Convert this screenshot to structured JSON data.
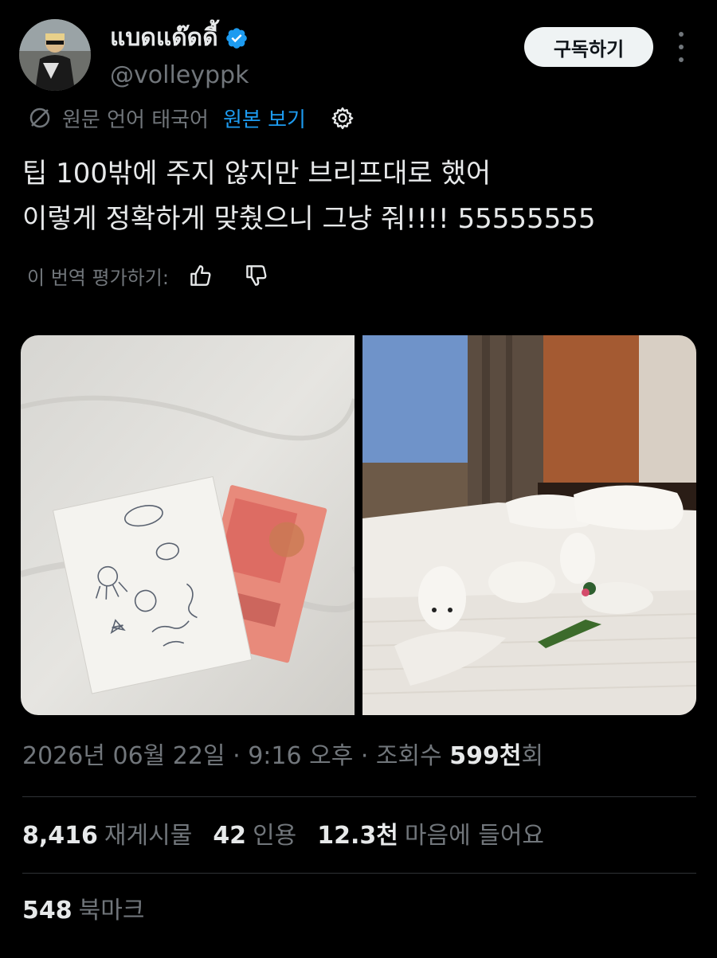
{
  "author": {
    "display_name": "แบดแด๊ดดี้",
    "handle": "@volleyppk",
    "verified": true,
    "verified_color": "#1d9bf0"
  },
  "header": {
    "subscribe_label": "구독하기"
  },
  "translation": {
    "source_label": "원문 언어 태국어",
    "show_original_label": "원본 보기"
  },
  "tweet": {
    "lines": [
      "팁 100밖에 주지 않지만 브리프대로 했어",
      "이렇게 정확하게 맞췄으니 그냥 줘!!!! 55555555"
    ]
  },
  "rate_translation": {
    "label": "이 번역 평가하기:"
  },
  "meta": {
    "date": "2026년 06월 22일",
    "time": "9:16 오후",
    "views_prefix": "조회수",
    "views_count": "599천",
    "views_suffix": "회",
    "separator": " · "
  },
  "stats": {
    "retweets": {
      "count": "8,416",
      "label": "재게시물"
    },
    "quotes": {
      "count": "42",
      "label": "인용"
    },
    "likes": {
      "count": "12.3천",
      "label": "마음에 들어요"
    },
    "bookmarks": {
      "count": "548",
      "label": "북마크"
    }
  },
  "colors": {
    "background": "#000000",
    "text": "#e7e9ea",
    "muted": "#71767b",
    "accent": "#1d9bf0",
    "divider": "#2f3336"
  }
}
